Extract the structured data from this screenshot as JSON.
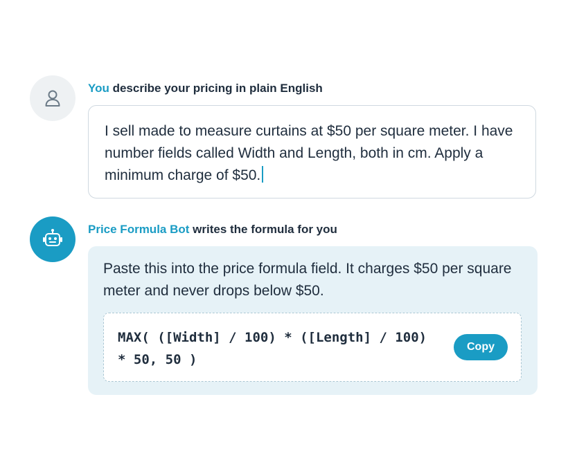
{
  "user_message": {
    "author": "You",
    "heading_rest": " describe your pricing in plain English",
    "text": "I sell made to measure curtains at $50 per square meter. I have number fields called Width and Length, both in cm. Apply a minimum charge of $50."
  },
  "bot_message": {
    "author": "Price Formula Bot",
    "heading_rest": " writes the formula for you",
    "text": "Paste this into the price formula field. It charges $50 per square meter and never drops below $50.",
    "code": "MAX( ([Width] / 100) * ([Length] / 100) * 50, 50 )",
    "copy_label": "Copy"
  },
  "icons": {
    "user_avatar": "person-icon",
    "bot_avatar": "robot-icon"
  },
  "colors": {
    "accent": "#1a9cc4",
    "text": "#1f2d3d",
    "bot_card_bg": "#e6f2f7",
    "user_avatar_bg": "#eef1f3"
  }
}
